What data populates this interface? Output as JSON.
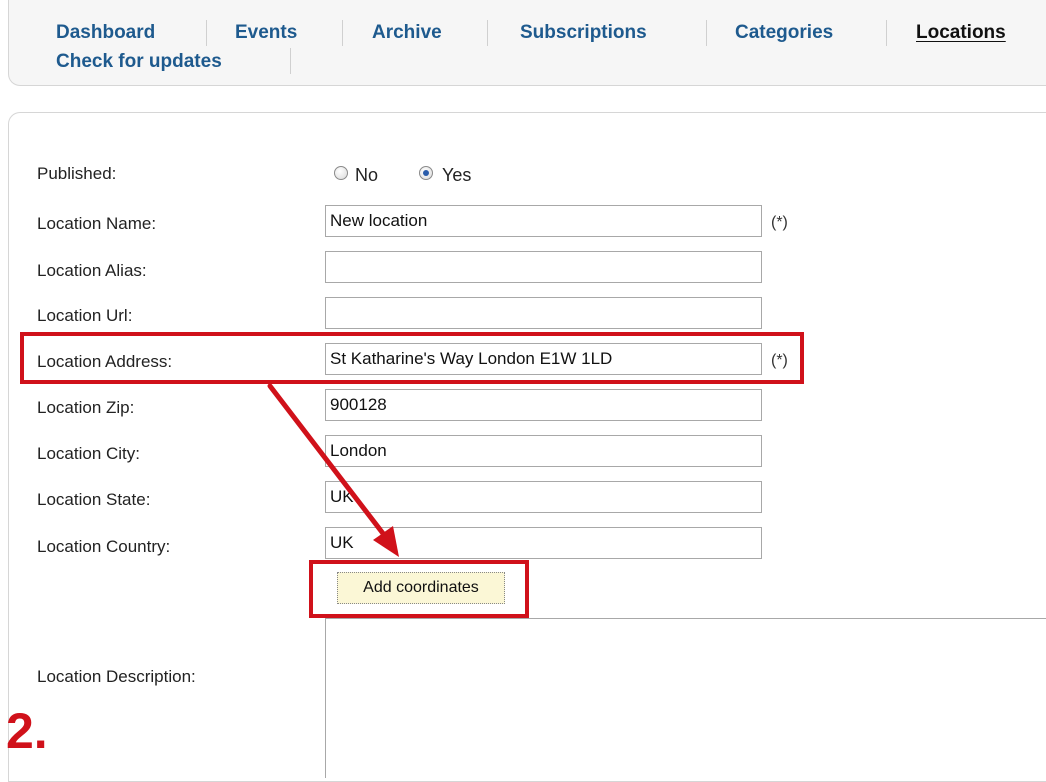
{
  "tabs": [
    "Dashboard",
    "Events",
    "Archive",
    "Subscriptions",
    "Categories",
    "Locations",
    "Check for updates"
  ],
  "form": {
    "published": {
      "label": "Published:",
      "no": "No",
      "yes": "Yes",
      "selected": "Yes"
    },
    "name": {
      "label": "Location Name:",
      "value": "New location",
      "req": "(*)"
    },
    "alias": {
      "label": "Location Alias:",
      "value": ""
    },
    "url": {
      "label": "Location Url:",
      "value": ""
    },
    "address": {
      "label": "Location Address:",
      "value": "St Katharine's Way London E1W 1LD",
      "req": "(*)"
    },
    "zip": {
      "label": "Location Zip:",
      "value": "900128"
    },
    "city": {
      "label": "Location City:",
      "value": "London"
    },
    "state": {
      "label": "Location State:",
      "value": "UK"
    },
    "country": {
      "label": "Location Country:",
      "value": "UK"
    },
    "add_coordinates": "Add coordinates",
    "description": {
      "label": "Location Description:"
    }
  },
  "annotation": {
    "step": "2.",
    "color": "#d0111a"
  }
}
